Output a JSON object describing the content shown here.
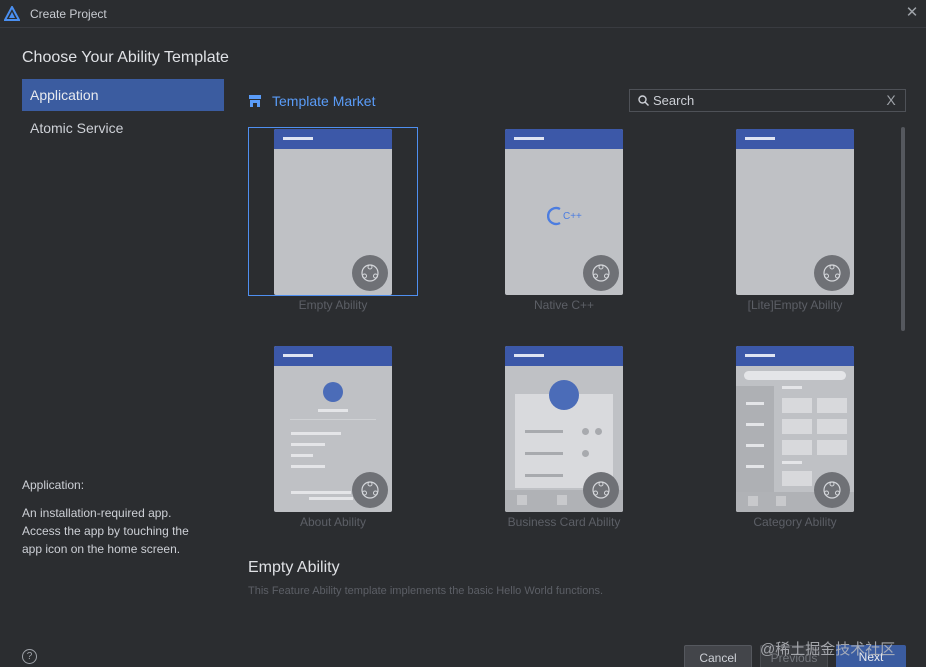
{
  "window": {
    "title": "Create Project",
    "logo_icon": "deveco-logo-icon",
    "close_icon": "close-icon"
  },
  "heading": "Choose Your Ability Template",
  "sidebar": {
    "items": [
      {
        "label": "Application",
        "active": true
      },
      {
        "label": "Atomic Service",
        "active": false
      }
    ],
    "description": {
      "title": "Application:",
      "text": "An installation-required app. Access the app by touching the app icon on the home screen."
    }
  },
  "market": {
    "label": "Template Market",
    "icon": "store-icon"
  },
  "search": {
    "value": "",
    "placeholder": "Search",
    "clear_glyph": "X"
  },
  "templates": [
    {
      "name": "Empty Ability",
      "selected": true
    },
    {
      "name": "Native C++",
      "selected": false,
      "logo_text": "C++"
    },
    {
      "name": "[Lite]Empty Ability",
      "selected": false
    },
    {
      "name": "About Ability",
      "selected": false
    },
    {
      "name": "Business Card Ability",
      "selected": false
    },
    {
      "name": "Category Ability",
      "selected": false
    }
  ],
  "detail": {
    "title": "Empty Ability",
    "description": "This Feature Ability template implements the basic Hello World functions."
  },
  "buttons": {
    "cancel": "Cancel",
    "previous": "Previous",
    "next": "Next"
  },
  "help": {
    "glyph": "?"
  },
  "watermark": "@稀土掘金技术社区",
  "colors": {
    "accent": "#3b5ca0",
    "link": "#5a9cf8",
    "card_bar": "#3c58a8",
    "card_body": "#bfc1c5",
    "background": "#2b2d30"
  }
}
